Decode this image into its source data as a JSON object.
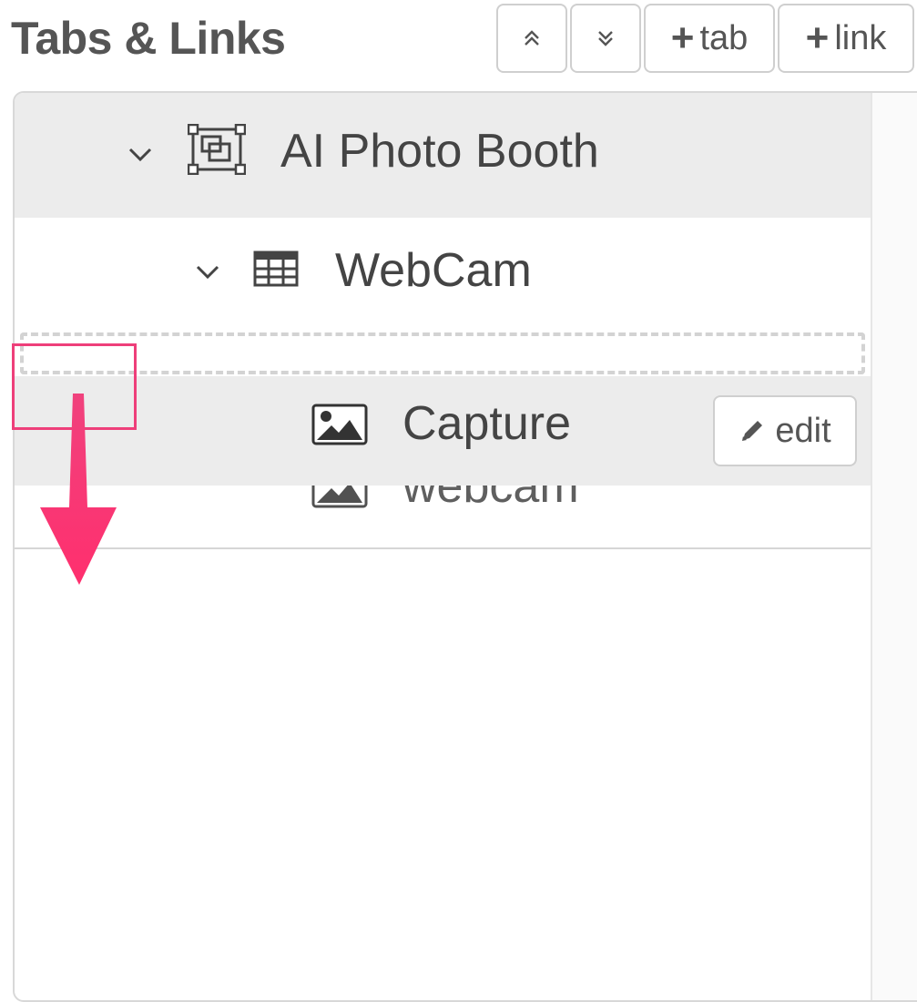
{
  "header": {
    "title": "Tabs & Links"
  },
  "toolbar": {
    "collapse_all_icon": "chevron-double-up-icon",
    "expand_all_icon": "chevron-double-down-icon",
    "add_tab_label": "tab",
    "add_link_label": "link"
  },
  "tree": {
    "tab": {
      "label": "AI Photo Booth",
      "icon": "tab-frame-icon",
      "expanded": true
    },
    "group": {
      "label": "WebCam",
      "icon": "grid-table-icon",
      "expanded": true
    },
    "items": [
      {
        "label": "Capture",
        "icon": "image-icon",
        "edit_label": "edit"
      },
      {
        "label": "webcam",
        "icon": "image-icon"
      }
    ]
  },
  "annotation": {
    "highlight_color": "#ee3f7a",
    "arrow_direction": "down"
  }
}
